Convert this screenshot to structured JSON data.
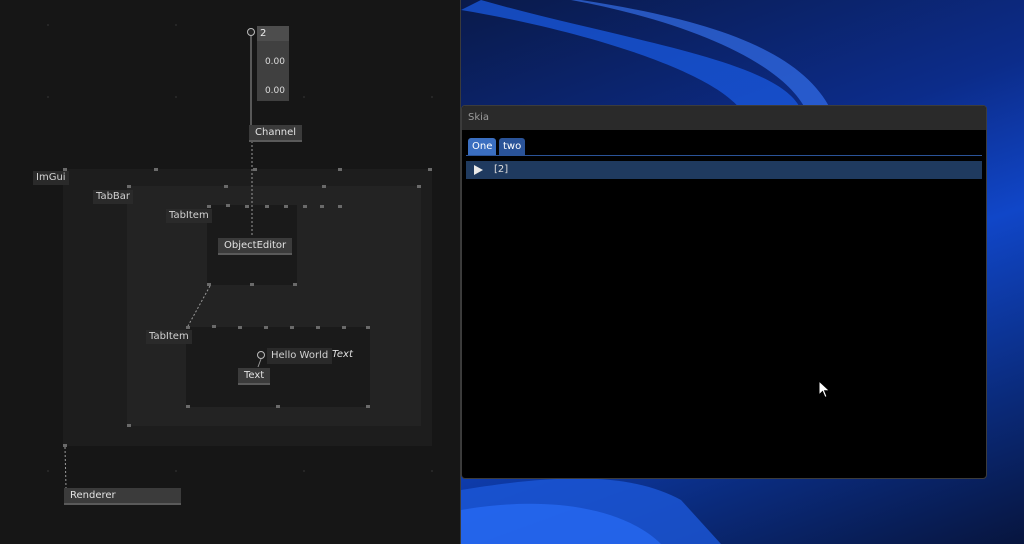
{
  "editor": {
    "io_box": {
      "header": "2",
      "values": [
        "0.00",
        "0.00"
      ]
    },
    "nodes": {
      "channel": "Channel",
      "object_editor": "ObjectEditor",
      "hello_world": "Hello World",
      "text_node": "Text",
      "text_type": "Text",
      "renderer": "Renderer"
    },
    "regions": {
      "imgui": "ImGui",
      "tabbar": "TabBar",
      "tabitem_1": "TabItem",
      "tabitem_2": "TabItem"
    }
  },
  "skia_window": {
    "title": "Skia",
    "tabs": [
      "One",
      "two"
    ],
    "tree_row": "[2]"
  },
  "colors": {
    "editor_bg": "#161616",
    "tab_active": "#3a6ec0",
    "tab_inactive": "#2a5398",
    "tree_row_bg": "#1f3a5f"
  }
}
